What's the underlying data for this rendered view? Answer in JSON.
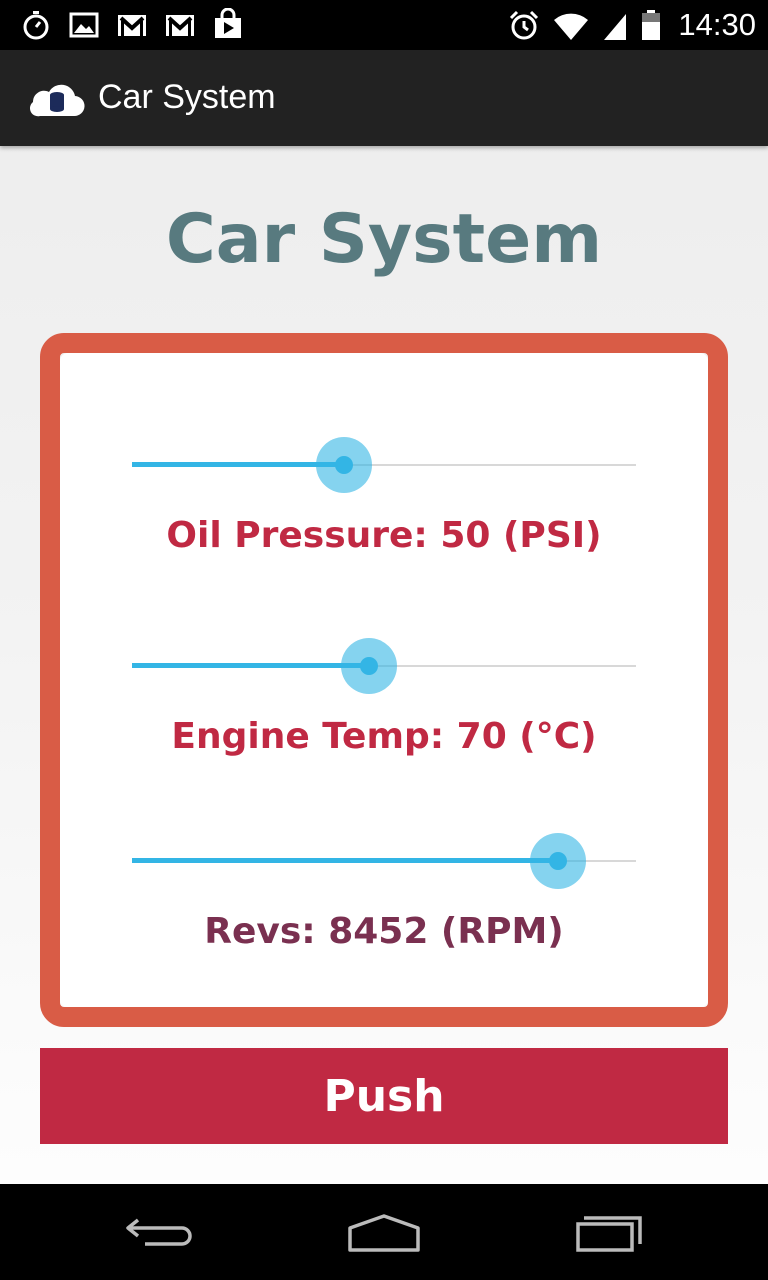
{
  "status_bar": {
    "time": "14:30",
    "left_icons": [
      "stopwatch-icon",
      "image-icon",
      "gmail-icon",
      "gmail-icon",
      "play-store-icon"
    ],
    "right_icons": [
      "alarm-icon",
      "wifi-icon",
      "signal-icon",
      "battery-icon"
    ]
  },
  "action_bar": {
    "title": "Car System",
    "icon": "cloud-database-icon"
  },
  "main": {
    "heading": "Car System",
    "sliders": [
      {
        "label": "Oil Pressure: 50 (PSI)",
        "value_fraction": 0.42,
        "label_color": "#c02943"
      },
      {
        "label": "Engine Temp: 70 (°C)",
        "value_fraction": 0.47,
        "label_color": "#c02943"
      },
      {
        "label": "Revs: 8452 (RPM)",
        "value_fraction": 0.845,
        "label_color": "#7a3050"
      }
    ],
    "push_label": "Push"
  },
  "nav_bar": {
    "icons": [
      "back-icon",
      "home-icon",
      "recent-apps-icon"
    ]
  },
  "colors": {
    "accent": "#33b5e5",
    "panel_border": "#d95c46",
    "button": "#c02943",
    "heading": "#587a7f"
  }
}
